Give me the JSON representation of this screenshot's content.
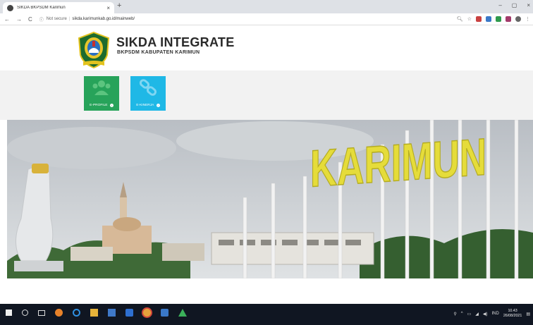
{
  "browser": {
    "tab_title": "SIKDA BKPSDM Karimun",
    "tab_close": "×",
    "new_tab": "+",
    "security": "Not secure",
    "url": "sikda.karimunkab.go.id/mainweb/",
    "window_controls": [
      "–",
      "▢",
      "×"
    ]
  },
  "header": {
    "title": "SIKDA INTEGRATE",
    "subtitle": "BKPSDM KABUPATEN KARIMUN"
  },
  "menu": {
    "tiles": [
      {
        "label": "E-PROFILE",
        "color": "#27a35a"
      },
      {
        "label": "E-KINERJA",
        "color": "#1fb8e6"
      }
    ]
  },
  "hero": {
    "sign_text": "KARIMUN"
  },
  "taskbar": {
    "lang": "IND",
    "time": "10.43",
    "date": "26/08/2021"
  },
  "colors": {
    "tab_strip": "#dee1e6",
    "menu_band": "#f2f2f2",
    "taskbar": "#101622"
  }
}
